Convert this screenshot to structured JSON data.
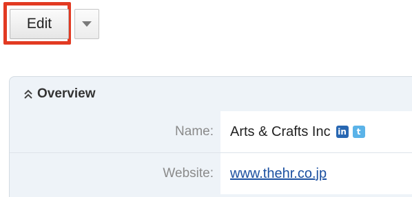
{
  "toolbar": {
    "edit_label": "Edit"
  },
  "panel": {
    "title": "Overview",
    "fields": {
      "name_label": "Name:",
      "name_value": "Arts & Crafts Inc",
      "website_label": "Website:",
      "website_value": "www.thehr.co.jp"
    }
  },
  "icons": {
    "dropdown": "caret-down-icon",
    "collapse": "double-chevron-up-icon",
    "linkedin": "linkedin-icon",
    "twitter": "twitter-icon",
    "linkedin_glyph": "in",
    "twitter_glyph": "t"
  },
  "colors": {
    "highlight": "#e23a22",
    "panel_bg": "#eef3f8",
    "link": "#1a4fa0"
  }
}
